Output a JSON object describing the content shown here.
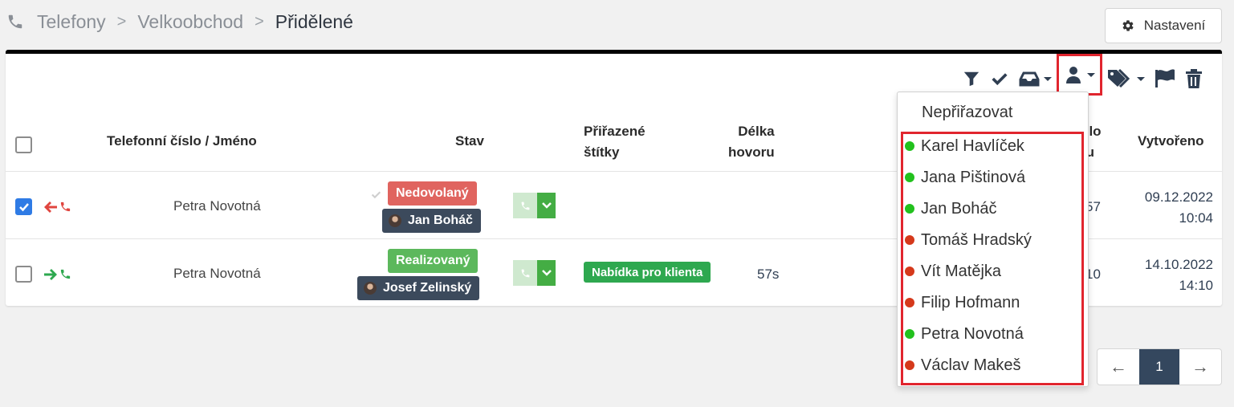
{
  "breadcrumb": {
    "items": [
      "Telefony",
      "Velkoobchod"
    ],
    "current": "Přidělené",
    "separator": ">"
  },
  "settings_button": {
    "label": "Nastavení"
  },
  "table": {
    "headers": {
      "phone_name": "Telefonní číslo / Jméno",
      "status": "Stav",
      "tags_line1": "Přiřazené",
      "tags_line2": "štítky",
      "duration_line1": "Délka",
      "duration_line2": "hovoru",
      "hidden_line1": "slo",
      "hidden_line2": "tu",
      "created": "Vytvořeno"
    },
    "rows": [
      {
        "checked": true,
        "direction": "incoming-missed",
        "name": "Petra Novotná",
        "status": "Nedovolaný",
        "status_color": "#e0645f",
        "user": "Jan Boháč",
        "tag": "",
        "duration": "",
        "partial": "57",
        "created_date": "09.12.2022",
        "created_time": "10:04"
      },
      {
        "checked": false,
        "direction": "outgoing",
        "name": "Petra Novotná",
        "status": "Realizovaný",
        "status_color": "#5cb85c",
        "user": "Josef Zelinský",
        "tag": "Nabídka pro klienta",
        "duration": "57s",
        "partial": "10",
        "created_date": "14.10.2022",
        "created_time": "14:10"
      }
    ]
  },
  "toolbar": {
    "icons": [
      "filter-icon",
      "check-icon",
      "inbox-icon",
      "user-icon",
      "tags-icon",
      "flag-icon",
      "trash-icon"
    ]
  },
  "assign_dropdown": {
    "none_label": "Nepřiřazovat",
    "users": [
      {
        "name": "Karel Havlíček",
        "status": "online",
        "color": "#22c11d"
      },
      {
        "name": "Jana Pištinová",
        "status": "online",
        "color": "#22c11d"
      },
      {
        "name": "Jan Boháč",
        "status": "online",
        "color": "#22c11d"
      },
      {
        "name": "Tomáš Hradský",
        "status": "offline",
        "color": "#d5391b"
      },
      {
        "name": "Vít Matějka",
        "status": "offline",
        "color": "#d5391b"
      },
      {
        "name": "Filip Hofmann",
        "status": "offline",
        "color": "#d5391b"
      },
      {
        "name": "Petra Novotná",
        "status": "online",
        "color": "#22c11d"
      },
      {
        "name": "Václav Makeš",
        "status": "offline",
        "color": "#d5391b"
      }
    ]
  },
  "pagination": {
    "prev": "←",
    "current": "1",
    "next": "→"
  },
  "colors": {
    "accent_dark": "#34475e",
    "highlight": "#e1252e",
    "checkbox": "#2f7be5"
  }
}
